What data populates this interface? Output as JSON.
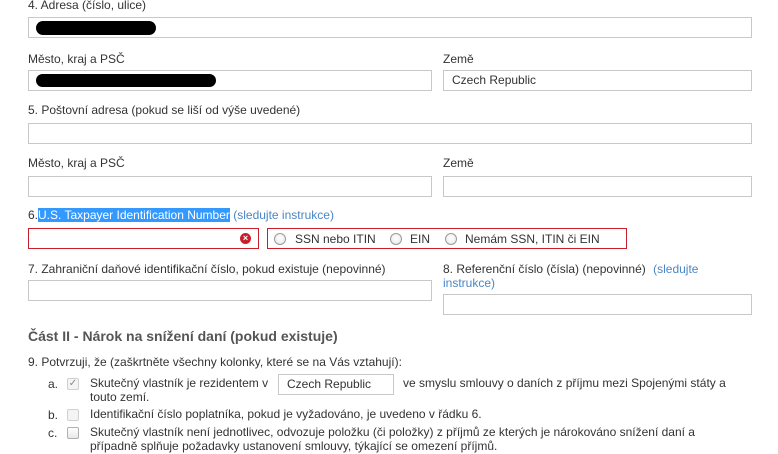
{
  "row4": {
    "label": "4. Adresa (číslo, ulice)",
    "address_value": ""
  },
  "row_city1": {
    "city_label": "Město, kraj a PSČ",
    "country_label": "Země",
    "country_value": "Czech Republic"
  },
  "row5": {
    "label": "5. Poštovní adresa (pokud se liší od výše uvedené)"
  },
  "row_city2": {
    "city_label": "Město, kraj a PSČ",
    "country_label": "Země"
  },
  "row6": {
    "number": "6.",
    "label": "U.S. Taxpayer Identification Number",
    "link": "(sledujte instrukce)",
    "clear_glyph": "×",
    "options": [
      {
        "label": "SSN nebo ITIN",
        "selected": false
      },
      {
        "label": "EIN",
        "selected": false
      },
      {
        "label": "Nemám SSN, ITIN či EIN",
        "selected": false
      }
    ]
  },
  "row7": {
    "label": "7. Zahraniční daňové identifikační číslo, pokud existuje (nepovinné)"
  },
  "row8": {
    "label_line1": "8.  Referenční  číslo  (čísla)  (nepovinné)",
    "link_line1": "(sledujte",
    "link_line2": "instrukce)"
  },
  "part2": {
    "title": "Část II - Nárok na snížení daní (pokud existuje)",
    "intro": "9. Potvrzuji, že (zaškrtněte všechny kolonky, které se na Vás vztahují):",
    "items": [
      {
        "letter": "a.",
        "checked": true,
        "check_glyph": "✓",
        "text_before": "Skutečný vlastník je rezidentem v",
        "country_value": "Czech Republic",
        "text_after_line1": "ve smyslu smlouvy o daních z příjmu mezi Spojenými státy a",
        "text_after_line2": "touto zemí."
      },
      {
        "letter": "b.",
        "checked": false,
        "text": "Identifikační číslo poplatníka, pokud je vyžadováno, je uvedeno v řádku 6."
      },
      {
        "letter": "c.",
        "checked": false,
        "text_line1": "Skutečný vlastník není jednotlivec, odvozuje položku (či položky) z příjmů ze kterých je nárokováno snížení daní a",
        "text_line2": "případně splňuje požadavky ustanovení smlouvy, týkající se omezení příjmů."
      }
    ]
  },
  "colors": {
    "accent_link": "#4a86c5",
    "error": "#c8202a",
    "selection": "#3399ff"
  }
}
